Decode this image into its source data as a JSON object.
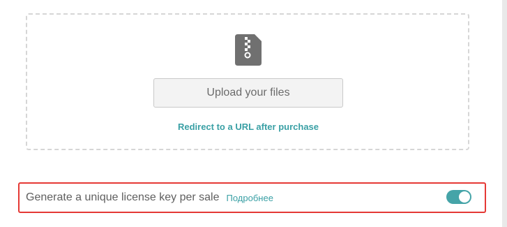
{
  "upload": {
    "icon": "zip-file-icon",
    "button_label": "Upload your files",
    "redirect_link": "Redirect to a URL after purchase"
  },
  "license": {
    "label": "Generate a unique license key per sale",
    "more_link": "Подробнее",
    "toggle_on": true
  },
  "colors": {
    "accent": "#3aa0a5",
    "toggle": "#45a4a8",
    "highlight_border": "#e53935",
    "icon": "#707070"
  }
}
